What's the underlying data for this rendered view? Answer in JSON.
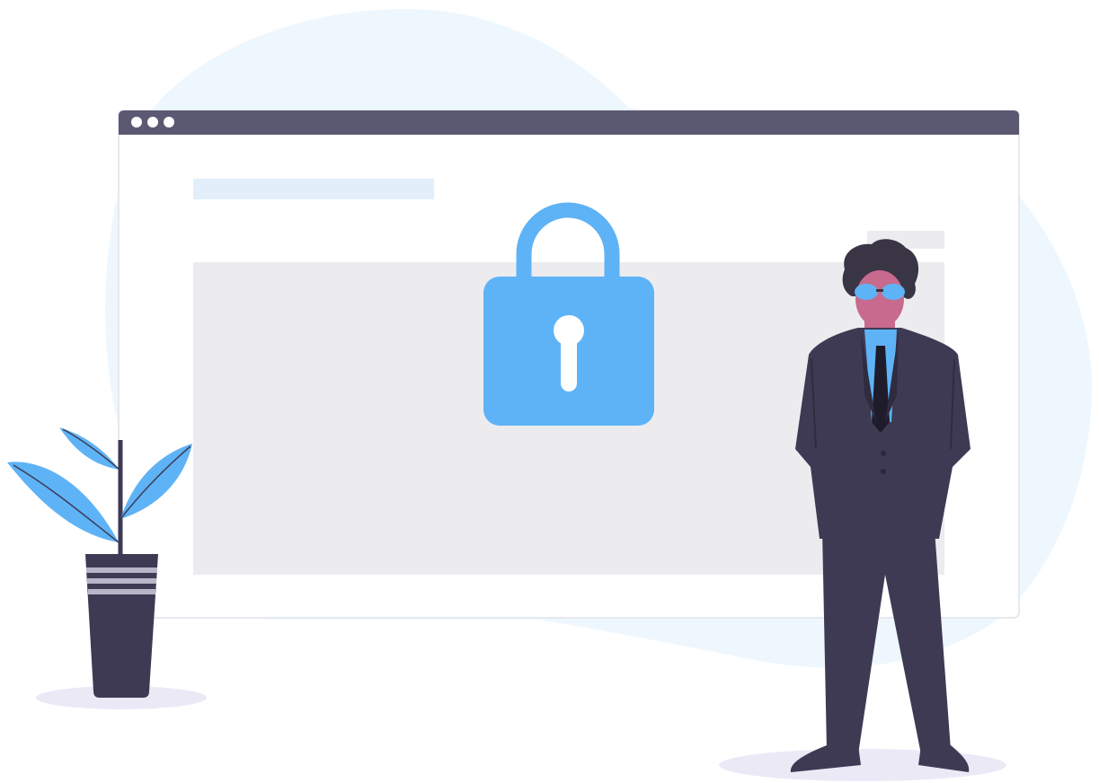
{
  "illustration": {
    "subject": "security-lock-browser",
    "icons": [
      "lock-icon",
      "window-dot-icon",
      "plant-icon",
      "person-figure"
    ],
    "colors": {
      "accent_blue": "#5eb3f6",
      "blob_background": "#eef7fe",
      "window_bar": "#5b5872",
      "window_body": "#ffffff",
      "content_block": "#ececef",
      "title_placeholder": "#e2effb",
      "suit": "#3e3a54",
      "skin": "#c76a8d",
      "hair": "#3a3545",
      "shadow": "#ece9f7"
    }
  }
}
